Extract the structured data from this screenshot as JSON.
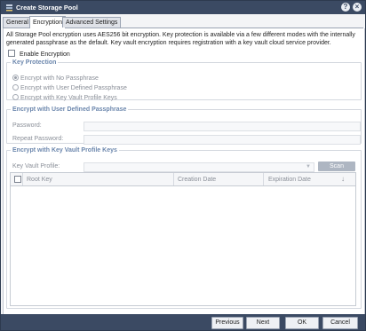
{
  "window": {
    "title": "Create Storage Pool",
    "help_icon": "help-icon",
    "close_icon": "close-icon"
  },
  "tabs": [
    {
      "label": "General",
      "active": false
    },
    {
      "label": "Encryption",
      "active": true
    },
    {
      "label": "Advanced Settings",
      "active": false
    }
  ],
  "description": "All Storage Pool encryption uses AES256 bit encryption. Key protection is available via a few different modes with the internally generated passphrase as the default. Key vault encryption requires registration with a key vault cloud service provider.",
  "enable_encryption": {
    "label": "Enable Encryption",
    "checked": false
  },
  "key_protection": {
    "legend": "Key Protection",
    "options": [
      {
        "label": "Encrypt with No Passphrase",
        "checked": true
      },
      {
        "label": "Encrypt with User Defined Passphrase",
        "checked": false
      },
      {
        "label": "Encrypt with Key Vault Profile Keys",
        "checked": false
      }
    ]
  },
  "passphrase": {
    "legend": "Encrypt with User Defined Passphrase",
    "password_label": "Password:",
    "password_value": "",
    "repeat_label": "Repeat Password:",
    "repeat_value": ""
  },
  "key_vault": {
    "legend": "Encrypt with Key Vault Profile Keys",
    "profile_label": "Key Vault Profile:",
    "profile_value": "",
    "scan_label": "Scan"
  },
  "grid": {
    "columns": [
      "Root Key",
      "Creation Date",
      "Expiration Date"
    ],
    "rows": []
  },
  "footer": {
    "previous_label": "Previous",
    "next_label": "Next",
    "ok_label": "OK",
    "cancel_label": "Cancel"
  },
  "colors": {
    "titlebar": "#3b4a63",
    "legend": "#6c87ad",
    "scan_button": "#aeb6c2"
  }
}
